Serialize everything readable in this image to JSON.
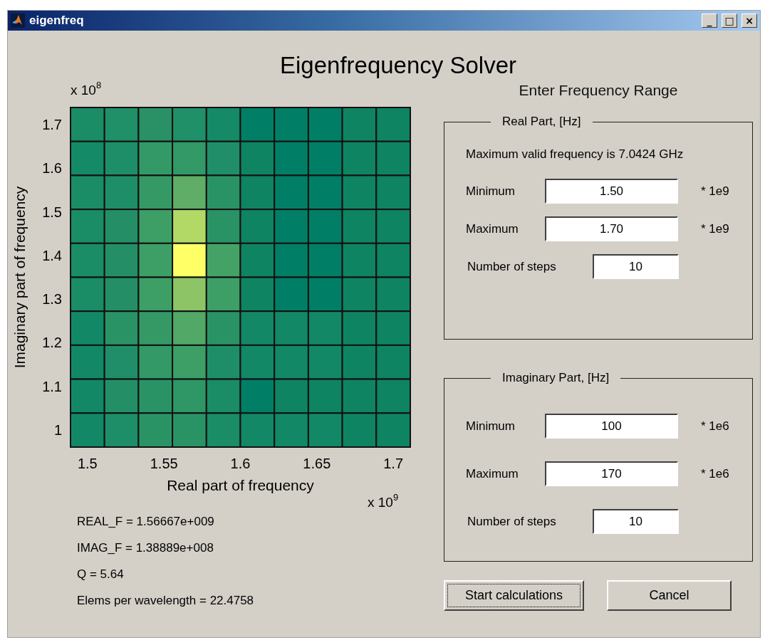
{
  "window": {
    "title": "eigenfreq",
    "controls": [
      "_",
      "□",
      "×"
    ]
  },
  "heading": "Eigenfrequency Solver",
  "plot": {
    "y_multiplier": "x 10",
    "y_exponent": "8",
    "x_multiplier": "x 10",
    "x_exponent": "9",
    "xlabel": "Real part of frequency",
    "ylabel": "Imaginary part of frequency",
    "xticks": [
      "1.5",
      "1.55",
      "1.6",
      "1.65",
      "1.7"
    ],
    "yticks": [
      "1.7",
      "1.6",
      "1.5",
      "1.4",
      "1.3",
      "1.2",
      "1.1",
      "1"
    ],
    "rows": [
      {
        "cells": [
          {
            "color": "#1a8c66"
          },
          {
            "color": "#209068"
          },
          {
            "color": "#2a9066"
          },
          {
            "color": "#209068"
          },
          {
            "color": "#148a66"
          },
          {
            "color": "#007f66"
          },
          {
            "color": "#007f66"
          },
          {
            "color": "#007f66"
          },
          {
            "color": "#0f8462"
          },
          {
            "color": "#0f8462"
          }
        ]
      },
      {
        "cells": [
          {
            "color": "#148a66"
          },
          {
            "color": "#1e8e68"
          },
          {
            "color": "#339966"
          },
          {
            "color": "#339966"
          },
          {
            "color": "#208e68"
          },
          {
            "color": "#0f8462"
          },
          {
            "color": "#007f66"
          },
          {
            "color": "#007f66"
          },
          {
            "color": "#0f8462"
          },
          {
            "color": "#0f8462"
          }
        ]
      },
      {
        "cells": [
          {
            "color": "#1a8c66"
          },
          {
            "color": "#1e8e68"
          },
          {
            "color": "#359966"
          },
          {
            "color": "#5fad66"
          },
          {
            "color": "#2a9366"
          },
          {
            "color": "#0f8462"
          },
          {
            "color": "#007f66"
          },
          {
            "color": "#007f66"
          },
          {
            "color": "#0f8462"
          },
          {
            "color": "#0f8462"
          }
        ]
      },
      {
        "cells": [
          {
            "color": "#1a8c66"
          },
          {
            "color": "#248f66"
          },
          {
            "color": "#3d9f66"
          },
          {
            "color": "#b2d966"
          },
          {
            "color": "#2a9366"
          },
          {
            "color": "#0f8462"
          },
          {
            "color": "#007f66"
          },
          {
            "color": "#007f66"
          },
          {
            "color": "#0f8462"
          },
          {
            "color": "#0f8462"
          }
        ]
      },
      {
        "cells": [
          {
            "color": "#1a8c66"
          },
          {
            "color": "#248f66"
          },
          {
            "color": "#3d9f66"
          },
          {
            "color": "#ffff66"
          },
          {
            "color": "#44a266"
          },
          {
            "color": "#0f8462"
          },
          {
            "color": "#007f66"
          },
          {
            "color": "#007f66"
          },
          {
            "color": "#0f8462"
          },
          {
            "color": "#0f8462"
          }
        ]
      },
      {
        "cells": [
          {
            "color": "#1a8c66"
          },
          {
            "color": "#248f66"
          },
          {
            "color": "#3d9f66"
          },
          {
            "color": "#8cc466"
          },
          {
            "color": "#3d9f66"
          },
          {
            "color": "#0f8462"
          },
          {
            "color": "#007f66"
          },
          {
            "color": "#007f66"
          },
          {
            "color": "#0f8462"
          },
          {
            "color": "#0f8462"
          }
        ]
      },
      {
        "cells": [
          {
            "color": "#128866"
          },
          {
            "color": "#2a9366"
          },
          {
            "color": "#359966"
          },
          {
            "color": "#52a866"
          },
          {
            "color": "#2a9366"
          },
          {
            "color": "#128866"
          },
          {
            "color": "#128866"
          },
          {
            "color": "#128866"
          },
          {
            "color": "#0f8462"
          },
          {
            "color": "#0f8462"
          }
        ]
      },
      {
        "cells": [
          {
            "color": "#128866"
          },
          {
            "color": "#208e68"
          },
          {
            "color": "#339966"
          },
          {
            "color": "#3d9f66"
          },
          {
            "color": "#1e8e68"
          },
          {
            "color": "#128866"
          },
          {
            "color": "#128866"
          },
          {
            "color": "#128866"
          },
          {
            "color": "#0f8462"
          },
          {
            "color": "#0f8462"
          }
        ]
      },
      {
        "cells": [
          {
            "color": "#128866"
          },
          {
            "color": "#248f66"
          },
          {
            "color": "#2a9366"
          },
          {
            "color": "#2f9666"
          },
          {
            "color": "#1a8c66"
          },
          {
            "color": "#007f66"
          },
          {
            "color": "#0f8462"
          },
          {
            "color": "#0f8462"
          },
          {
            "color": "#0f8462"
          },
          {
            "color": "#0f8462"
          }
        ]
      },
      {
        "cells": [
          {
            "color": "#128866"
          },
          {
            "color": "#1e8e68"
          },
          {
            "color": "#2a9366"
          },
          {
            "color": "#2a9366"
          },
          {
            "color": "#1a8c66"
          },
          {
            "color": "#128866"
          },
          {
            "color": "#128866"
          },
          {
            "color": "#128866"
          },
          {
            "color": "#0f8462"
          },
          {
            "color": "#0f8462"
          }
        ]
      }
    ]
  },
  "results": [
    "REAL_F = 1.56667e+009",
    "IMAG_F = 1.38889e+008",
    "Q = 5.64",
    "Elems per wavelength = 22.4758"
  ],
  "range_title": "Enter Frequency Range",
  "groups": [
    {
      "legend": "Real Part, [Hz]",
      "note": "Maximum valid frequency is 7.0424 GHz",
      "fields": [
        {
          "kind": "wide",
          "label": "Minimum",
          "value": "1.50",
          "unit": "* 1e9"
        },
        {
          "kind": "wide",
          "label": "Maximum",
          "value": "1.70",
          "unit": "* 1e9"
        },
        {
          "kind": "narrow",
          "label": "Number of steps",
          "value": "10"
        }
      ]
    },
    {
      "legend": "Imaginary Part, [Hz]",
      "fields": [
        {
          "kind": "wide",
          "label": "Minimum",
          "value": "100",
          "unit": "* 1e6"
        },
        {
          "kind": "wide",
          "label": "Maximum",
          "value": "170",
          "unit": "* 1e6"
        },
        {
          "kind": "narrow",
          "label": "Number of steps",
          "value": "10"
        }
      ]
    }
  ],
  "buttons": [
    {
      "label": "Start calculations",
      "focused": true
    },
    {
      "label": "Cancel",
      "focused": false
    }
  ]
}
